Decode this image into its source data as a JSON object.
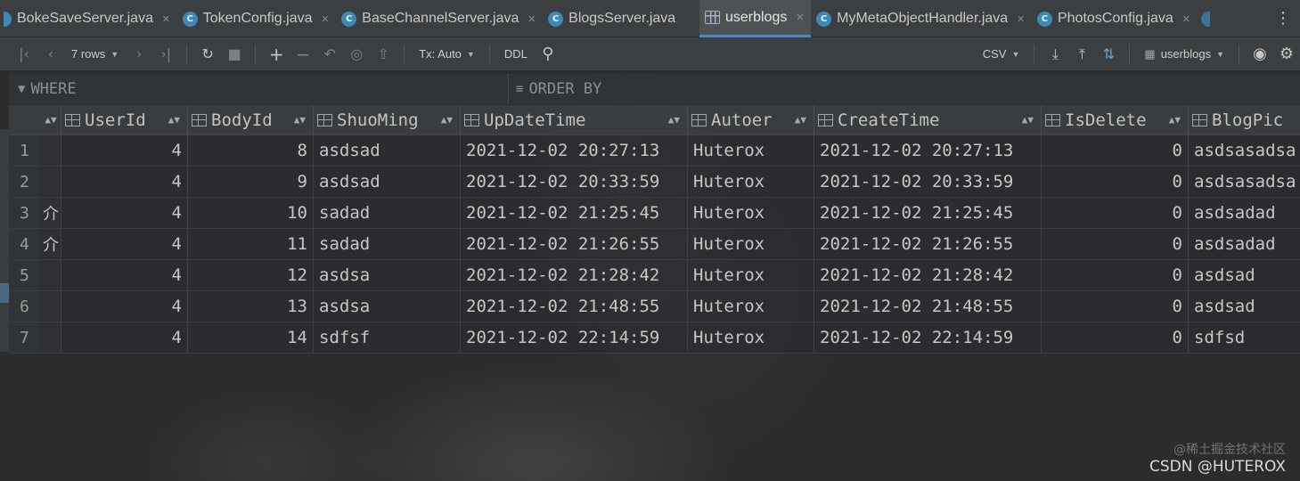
{
  "tabs": [
    {
      "label": "BokeSaveServer.java",
      "icon": "java-class-icon",
      "close": "×"
    },
    {
      "label": "TokenConfig.java",
      "icon": "java-class-icon",
      "close": "×"
    },
    {
      "label": "BaseChannelServer.java",
      "icon": "java-class-icon",
      "close": "×"
    },
    {
      "label": "BlogsServer.java",
      "icon": "java-class-icon",
      "close": "×"
    },
    {
      "label": "userblogs",
      "icon": "table-icon",
      "close": "×",
      "active": true
    },
    {
      "label": "MyMetaObjectHandler.java",
      "icon": "java-class-icon",
      "close": "×"
    },
    {
      "label": "PhotosConfig.java",
      "icon": "java-class-icon",
      "close": "×"
    }
  ],
  "toolbar": {
    "rows_label": "7 rows",
    "tx_label": "Tx: Auto",
    "ddl_label": "DDL",
    "export_format": "CSV",
    "table_selector": "userblogs"
  },
  "filter": {
    "where_label": "WHERE",
    "order_label": "ORDER BY"
  },
  "columns": [
    "UserId",
    "BodyId",
    "ShuoMing",
    "UpDateTime",
    "Autoer",
    "CreateTime",
    "IsDelete",
    "BlogPic"
  ],
  "rows": [
    {
      "num": "1",
      "mark": "",
      "cells": [
        "4",
        "8",
        "asdsad",
        "2021-12-02 20:27:13",
        "Huterox",
        "2021-12-02 20:27:13",
        "0",
        "asdsasadsa"
      ]
    },
    {
      "num": "2",
      "mark": "",
      "cells": [
        "4",
        "9",
        "asdsad",
        "2021-12-02 20:33:59",
        "Huterox",
        "2021-12-02 20:33:59",
        "0",
        "asdsasadsa"
      ]
    },
    {
      "num": "3",
      "mark": "介",
      "cells": [
        "4",
        "10",
        "sadad",
        "2021-12-02 21:25:45",
        "Huterox",
        "2021-12-02 21:25:45",
        "0",
        "asdsadad"
      ]
    },
    {
      "num": "4",
      "mark": "介",
      "cells": [
        "4",
        "11",
        "sadad",
        "2021-12-02 21:26:55",
        "Huterox",
        "2021-12-02 21:26:55",
        "0",
        "asdsadad"
      ]
    },
    {
      "num": "5",
      "mark": "",
      "cells": [
        "4",
        "12",
        "asdsa",
        "2021-12-02 21:28:42",
        "Huterox",
        "2021-12-02 21:28:42",
        "0",
        "asdsad"
      ]
    },
    {
      "num": "6",
      "mark": "",
      "cells": [
        "4",
        "13",
        "asdsa",
        "2021-12-02 21:48:55",
        "Huterox",
        "2021-12-02 21:48:55",
        "0",
        "asdsad"
      ]
    },
    {
      "num": "7",
      "mark": "",
      "cells": [
        "4",
        "14",
        "sdfsf",
        "2021-12-02 22:14:59",
        "Huterox",
        "2021-12-02 22:14:59",
        "0",
        "sdfsd"
      ]
    }
  ],
  "watermark": {
    "line1": "@稀土掘金技术社区",
    "line2": "CSDN @HUTEROX"
  },
  "colors": {
    "accent": "#4a88c7",
    "background": "#2b2d30",
    "toolbar": "#3c3f41"
  }
}
